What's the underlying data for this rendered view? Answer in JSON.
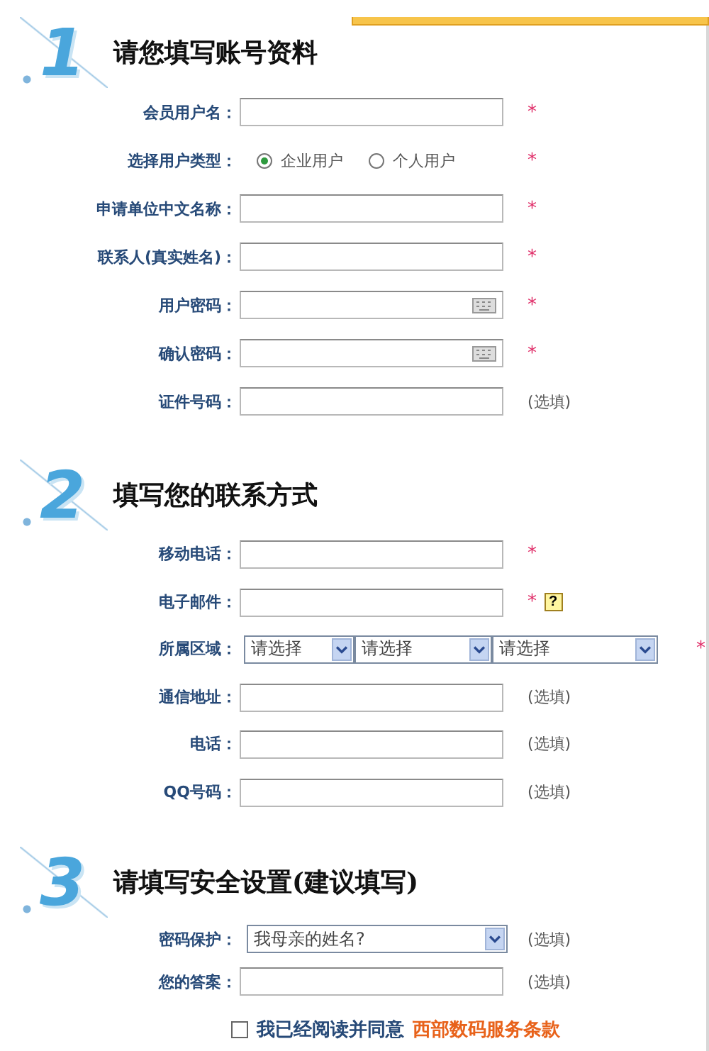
{
  "sections": [
    {
      "number": "1",
      "title": "请您填写账号资料",
      "rows": [
        {
          "label": "会员用户名：",
          "kind": "text",
          "marker": {
            "kind": "required",
            "text": "*"
          }
        },
        {
          "label": "选择用户类型：",
          "kind": "radio",
          "options": [
            {
              "label": "企业用户",
              "selected": true
            },
            {
              "label": "个人用户",
              "selected": false
            }
          ],
          "marker": {
            "kind": "required",
            "text": "*"
          }
        },
        {
          "label": "申请单位中文名称：",
          "kind": "text",
          "marker": {
            "kind": "required",
            "text": "*"
          }
        },
        {
          "label": "联系人(真实姓名)：",
          "kind": "text",
          "marker": {
            "kind": "required",
            "text": "*"
          }
        },
        {
          "label": "用户密码：",
          "kind": "password",
          "marker": {
            "kind": "required",
            "text": "*"
          }
        },
        {
          "label": "确认密码：",
          "kind": "password",
          "marker": {
            "kind": "required",
            "text": "*"
          }
        },
        {
          "label": "证件号码：",
          "kind": "text",
          "marker": {
            "kind": "optional",
            "text": "(选填)"
          }
        }
      ]
    },
    {
      "number": "2",
      "title": "填写您的联系方式",
      "rows": [
        {
          "label": "移动电话：",
          "kind": "text",
          "marker": {
            "kind": "required",
            "text": "*"
          }
        },
        {
          "label": "电子邮件：",
          "kind": "text",
          "marker": {
            "kind": "required",
            "text": "*"
          },
          "help": "?"
        },
        {
          "label": "所属区域：",
          "kind": "selects",
          "selects": [
            "请选择",
            "请选择",
            "请选择"
          ],
          "marker": {
            "kind": "required",
            "text": "*"
          }
        },
        {
          "label": "通信地址：",
          "kind": "text",
          "marker": {
            "kind": "optional",
            "text": "(选填)"
          }
        },
        {
          "label": "电话：",
          "kind": "text",
          "marker": {
            "kind": "optional",
            "text": "(选填)"
          }
        },
        {
          "label": "QQ号码：",
          "kind": "text",
          "marker": {
            "kind": "optional",
            "text": "(选填)"
          }
        }
      ]
    },
    {
      "number": "3",
      "title": "请填写安全设置(建议填写)",
      "rows": [
        {
          "label": "密码保护：",
          "kind": "select",
          "value": "我母亲的姓名?",
          "marker": {
            "kind": "optional",
            "text": "(选填)"
          }
        },
        {
          "label": "您的答案：",
          "kind": "text",
          "marker": {
            "kind": "optional",
            "text": "(选填)"
          }
        }
      ]
    }
  ],
  "agreement": {
    "checked": false,
    "text": "我已经阅读并同意",
    "link": "西部数码服务条款"
  }
}
